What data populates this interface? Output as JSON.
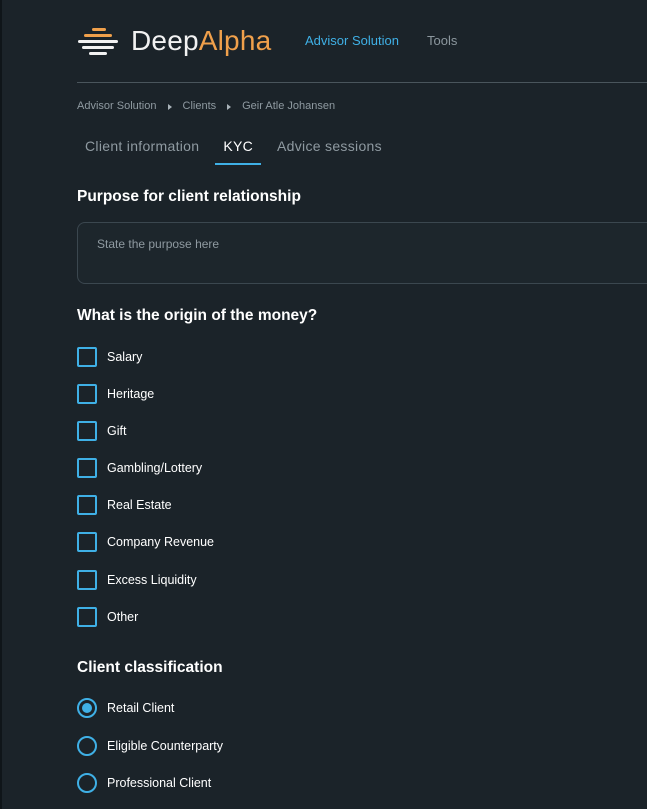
{
  "app": {
    "logo_deep": "Deep",
    "logo_alpha": "Alpha",
    "nav": {
      "advisor_solution": "Advisor Solution",
      "tools": "Tools"
    },
    "colors": {
      "background": "#1b2329",
      "accent": "#3fb0e6",
      "brand_orange": "#f0a04b",
      "muted_text": "#8f9aa1"
    }
  },
  "breadcrumb": [
    "Advisor Solution",
    "Clients",
    "Geir Atle Johansen"
  ],
  "tabs": [
    {
      "label": "Client information",
      "active": false
    },
    {
      "label": "KYC",
      "active": true
    },
    {
      "label": "Advice sessions",
      "active": false
    }
  ],
  "purpose": {
    "title": "Purpose for client relationship",
    "placeholder": "State the purpose here",
    "value": ""
  },
  "origin": {
    "title": "What is the origin of the money?",
    "options": [
      {
        "label": "Salary",
        "checked": false
      },
      {
        "label": "Heritage",
        "checked": false
      },
      {
        "label": "Gift",
        "checked": false
      },
      {
        "label": "Gambling/Lottery",
        "checked": false
      },
      {
        "label": "Real Estate",
        "checked": false
      },
      {
        "label": "Company Revenue",
        "checked": false
      },
      {
        "label": "Excess Liquidity",
        "checked": false
      },
      {
        "label": "Other",
        "checked": false
      }
    ]
  },
  "classification": {
    "title": "Client classification",
    "options": [
      {
        "label": "Retail Client",
        "selected": true
      },
      {
        "label": "Eligible Counterparty",
        "selected": false
      },
      {
        "label": "Professional Client",
        "selected": false
      }
    ]
  }
}
